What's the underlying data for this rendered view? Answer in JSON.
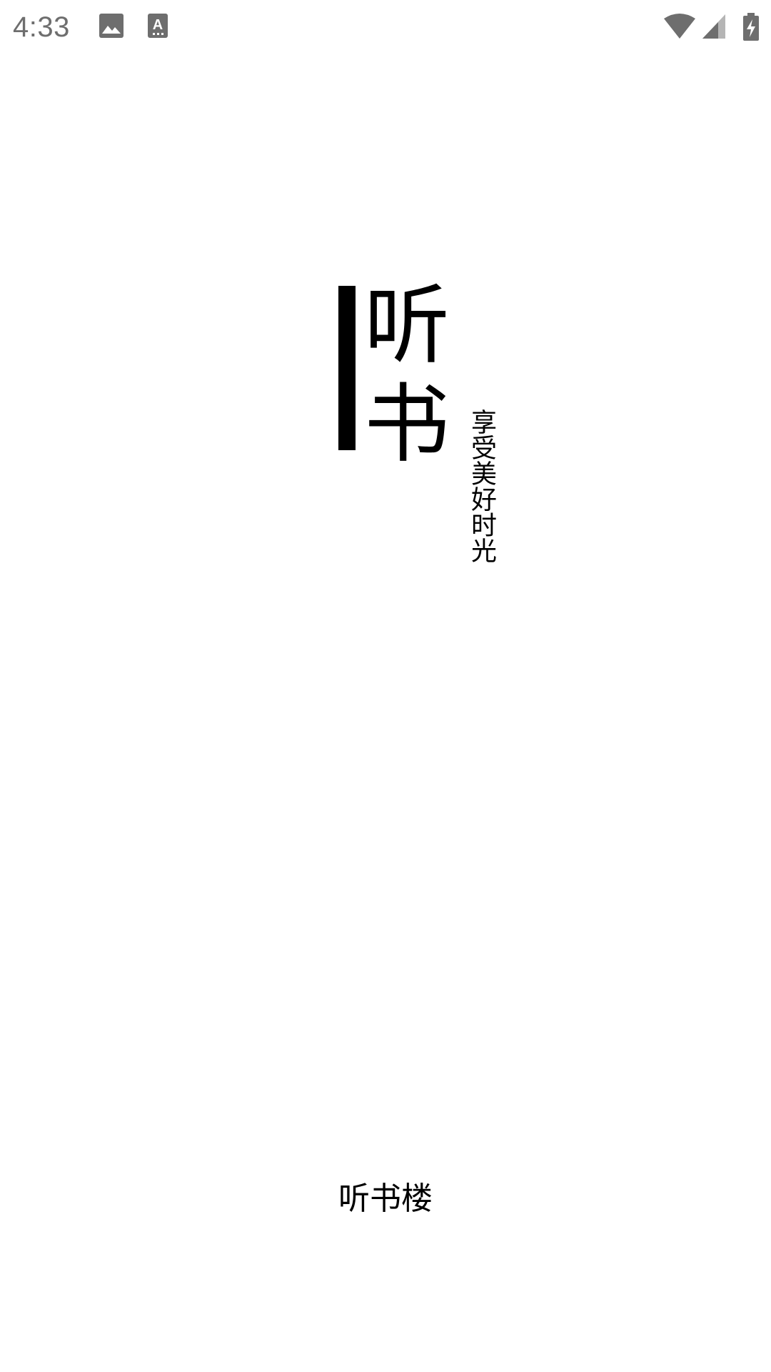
{
  "status_bar": {
    "time": "4:33",
    "icons": [
      "image-notification-icon",
      "font-notification-icon",
      "wifi-icon",
      "signal-icon",
      "battery-charging-icon"
    ],
    "icon_color": "#6e6e6e"
  },
  "splash": {
    "logo_chars": [
      "听",
      "书"
    ],
    "slogan": "享受美好时光",
    "app_name": "听书楼",
    "accent_color": "#000000",
    "background_color": "#ffffff"
  }
}
